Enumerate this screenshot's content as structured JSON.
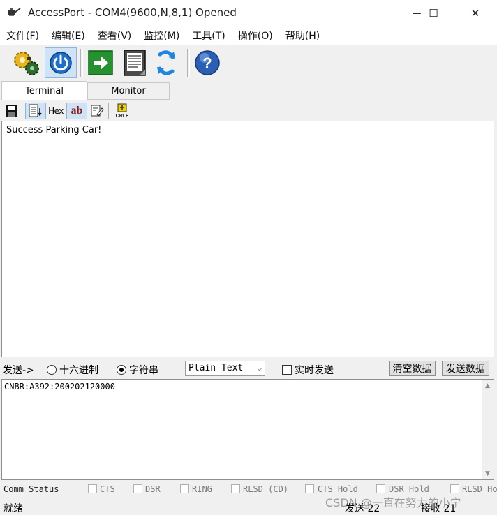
{
  "window": {
    "title": "AccessPort - COM4(9600,N,8,1) Opened",
    "minimize": "—",
    "maximize": "☐",
    "close": "✕"
  },
  "menu": {
    "items": [
      "文件(F)",
      "编辑(E)",
      "查看(V)",
      "监控(M)",
      "工具(T)",
      "操作(O)",
      "帮助(H)"
    ]
  },
  "toolbar": {
    "icons": [
      "settings-gears-icon",
      "power-icon",
      "arrow-right-icon",
      "document-icon",
      "refresh-icon",
      "help-icon"
    ],
    "help_glyph": "?"
  },
  "tabs": [
    {
      "label": "Terminal",
      "selected": true
    },
    {
      "label": "Monitor",
      "selected": false
    }
  ],
  "terminal_tools": {
    "hex": "Hex",
    "ab": "ab",
    "crlf": "CRLF"
  },
  "receive": {
    "text": "Success Parking Car!"
  },
  "send_bar": {
    "label": "发送->",
    "radio_hex": "十六进制",
    "radio_string": "字符串",
    "selected_radio": "字符串",
    "format_value": "Plain Text",
    "realtime_label": "实时发送",
    "realtime_checked": false,
    "clear_button": "清空数据",
    "send_button": "发送数据"
  },
  "send_input": {
    "value": "CNBR:A392:200202120000"
  },
  "comm_status": {
    "label": "Comm Status",
    "signals": [
      "CTS",
      "DSR",
      "RING",
      "RLSD (CD)",
      "CTS Hold",
      "DSR Hold",
      "RLSD Ho"
    ]
  },
  "status_bar": {
    "ready": "就绪",
    "sent": "发送 22",
    "received": "接收 21"
  },
  "watermark": "CSDN @一直在努力的小宁",
  "colors": {
    "accent_blue": "#1e6fc9",
    "toolbar_active": "#cfe3f7"
  }
}
